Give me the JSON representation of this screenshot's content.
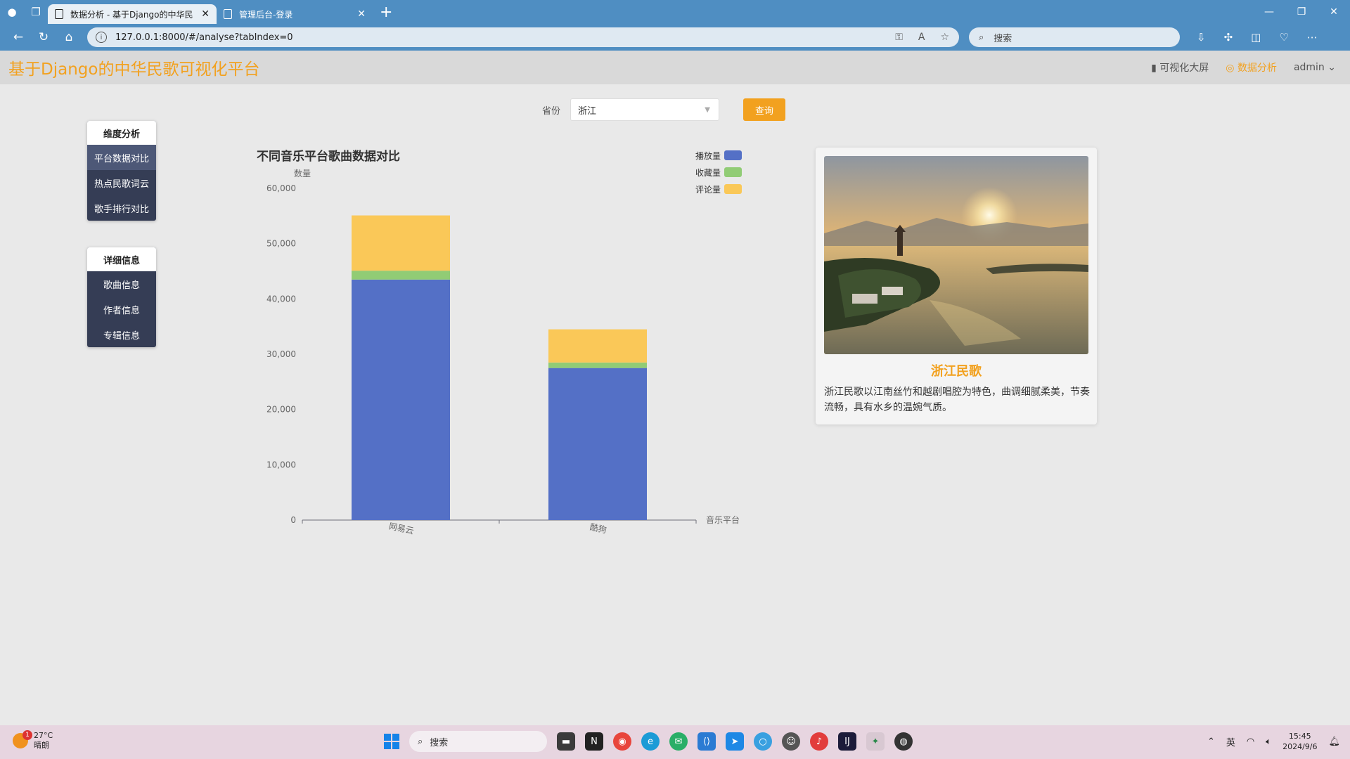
{
  "browser": {
    "tabs": [
      {
        "title": "数据分析 - 基于Django的中华民"
      },
      {
        "title": "管理后台-登录"
      }
    ],
    "url": "127.0.0.1:8000/#/analyse?tabIndex=0",
    "search_placeholder": "搜索"
  },
  "header": {
    "title": "基于Django的中华民歌可视化平台",
    "nav": {
      "screen": "可视化大屏",
      "analysis": "数据分析",
      "user": "admin"
    }
  },
  "sidebar": {
    "groups": [
      {
        "title": "维度分析",
        "items": [
          {
            "label": "平台数据对比"
          },
          {
            "label": "热点民歌词云"
          },
          {
            "label": "歌手排行对比"
          }
        ]
      },
      {
        "title": "详细信息",
        "items": [
          {
            "label": "歌曲信息"
          },
          {
            "label": "作者信息"
          },
          {
            "label": "专辑信息"
          }
        ]
      }
    ]
  },
  "filter": {
    "label": "省份",
    "value": "浙江",
    "button": "查询"
  },
  "chart_data": {
    "type": "bar",
    "stacked": true,
    "title": "不同音乐平台歌曲数据对比",
    "xlabel": "音乐平台",
    "ylabel": "数量",
    "categories": [
      "网易云",
      "酷狗"
    ],
    "series": [
      {
        "name": "播放量",
        "color": "#5470c6",
        "values": [
          43500,
          27500
        ]
      },
      {
        "name": "收藏量",
        "color": "#91cc75",
        "values": [
          1600,
          1000
        ]
      },
      {
        "name": "评论量",
        "color": "#fac858",
        "values": [
          10000,
          6000
        ]
      }
    ],
    "ylim": [
      0,
      60000
    ],
    "yticks": [
      0,
      10000,
      20000,
      30000,
      40000,
      50000,
      60000
    ],
    "ytick_labels": [
      "0",
      "10,000",
      "20,000",
      "30,000",
      "40,000",
      "50,000",
      "60,000"
    ],
    "legend": "top-right",
    "grid": false
  },
  "card": {
    "title": "浙江民歌",
    "description": "浙江民歌以江南丝竹和越剧唱腔为特色，曲调细腻柔美，节奏流畅，具有水乡的温婉气质。"
  },
  "taskbar": {
    "temperature": "27°C",
    "weather": "晴朗",
    "weather_badge": "1",
    "search": "搜索",
    "lang": "英",
    "time": "15:45",
    "date": "2024/9/6"
  }
}
